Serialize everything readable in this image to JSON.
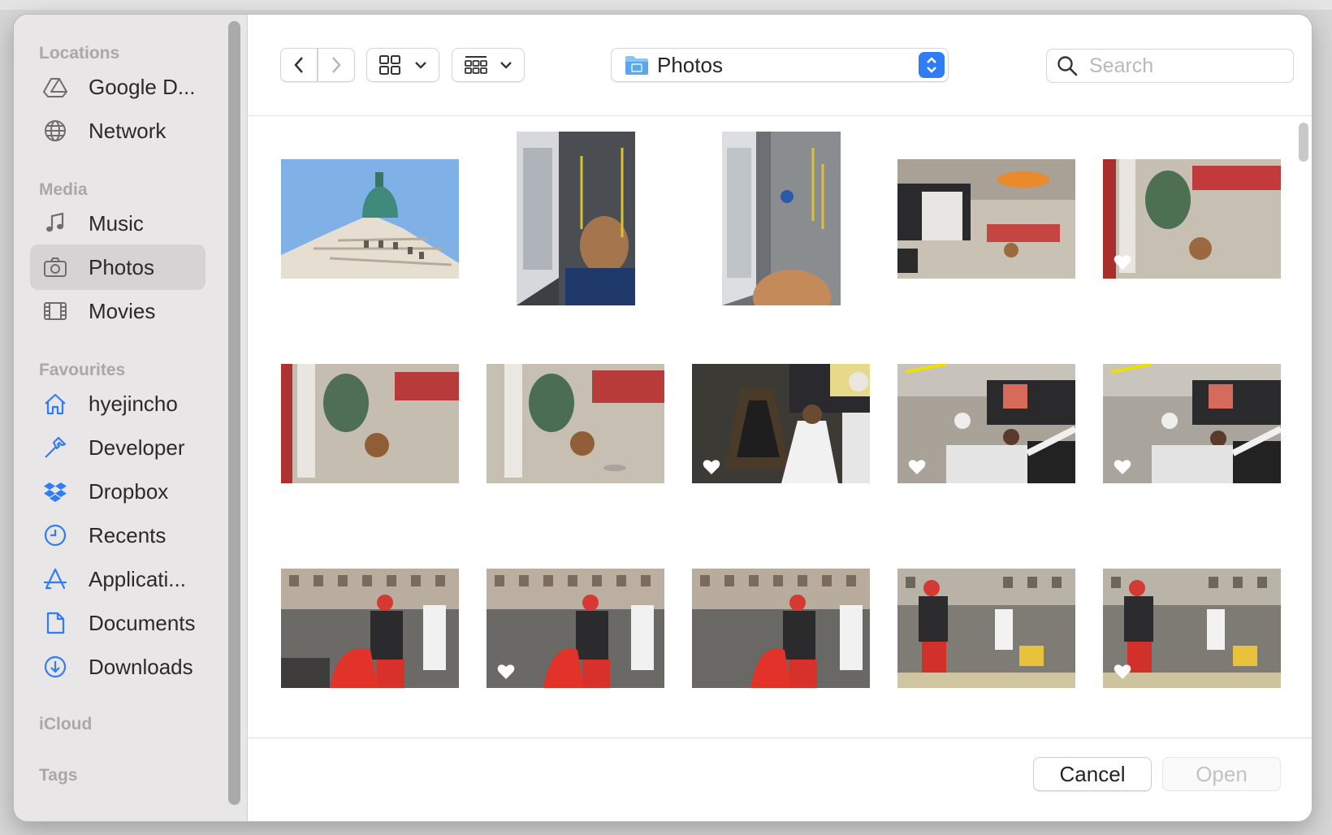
{
  "sidebar": {
    "sections": {
      "locations": "Locations",
      "media": "Media",
      "favourites": "Favourites",
      "icloud": "iCloud",
      "tags": "Tags"
    },
    "items": {
      "google_drive": "Google D...",
      "network": "Network",
      "music": "Music",
      "photos": "Photos",
      "movies": "Movies",
      "home": "hyejincho",
      "developer": "Developer",
      "dropbox": "Dropbox",
      "recents": "Recents",
      "applications": "Applicati...",
      "documents": "Documents",
      "downloads": "Downloads"
    },
    "selected": "photos",
    "accent_color": "#2f7cf6"
  },
  "toolbar": {
    "location_label": "Photos",
    "search_placeholder": "Search"
  },
  "footer": {
    "cancel_label": "Cancel",
    "open_label": "Open"
  }
}
